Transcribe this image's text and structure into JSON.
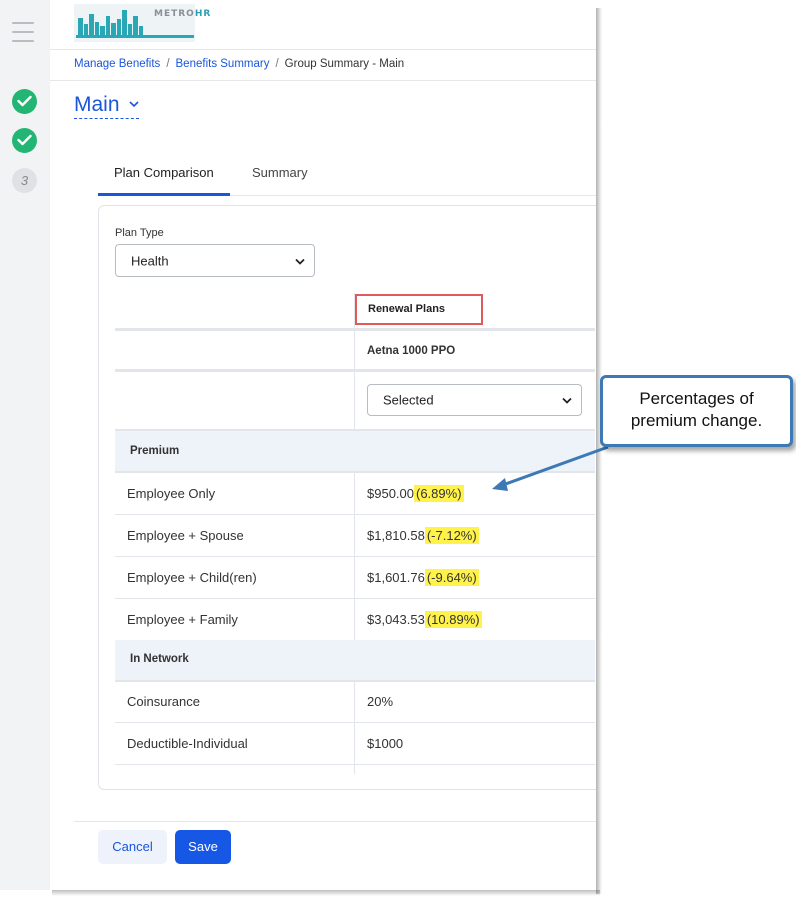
{
  "app": {
    "logo_text": "METRO",
    "logo_accent": "HR"
  },
  "steps": [
    {
      "state": "done"
    },
    {
      "state": "done"
    },
    {
      "state": "pending",
      "label": "3"
    }
  ],
  "breadcrumb": {
    "items": [
      "Manage Benefits",
      "Benefits Summary"
    ],
    "separator": "/",
    "current": "Group Summary - Main"
  },
  "page": {
    "title": "Main"
  },
  "tabs": [
    {
      "label": "Plan Comparison",
      "active": true
    },
    {
      "label": "Summary",
      "active": false
    }
  ],
  "plan_type": {
    "label": "Plan Type",
    "selected": "Health"
  },
  "table": {
    "group_header": "Renewal Plans",
    "plan_name": "Aetna 1000 PPO",
    "plan_select": "Selected",
    "sections": [
      {
        "name": "Premium",
        "rows": [
          {
            "label": "Employee Only",
            "value": "$950.00",
            "change": "(6.89%)"
          },
          {
            "label": "Employee + Spouse",
            "value": "$1,810.58",
            "change": "(-7.12%)"
          },
          {
            "label": "Employee + Child(ren)",
            "value": "$1,601.76",
            "change": "(-9.64%)"
          },
          {
            "label": "Employee + Family",
            "value": "$3,043.53",
            "change": "(10.89%)"
          }
        ]
      },
      {
        "name": "In Network",
        "rows": [
          {
            "label": "Coinsurance",
            "value": "20%"
          },
          {
            "label": "Deductible-Individual",
            "value": "$1000"
          }
        ]
      }
    ]
  },
  "footer": {
    "cancel_label": "Cancel",
    "save_label": "Save"
  },
  "callout": {
    "line1": "Percentages of",
    "line2": "premium change."
  },
  "colors": {
    "accent": "#1a56db",
    "success": "#22b573",
    "highlight": "#fff24a",
    "callout_border": "#3c79b5",
    "annotation_box": "#e05a5a"
  }
}
